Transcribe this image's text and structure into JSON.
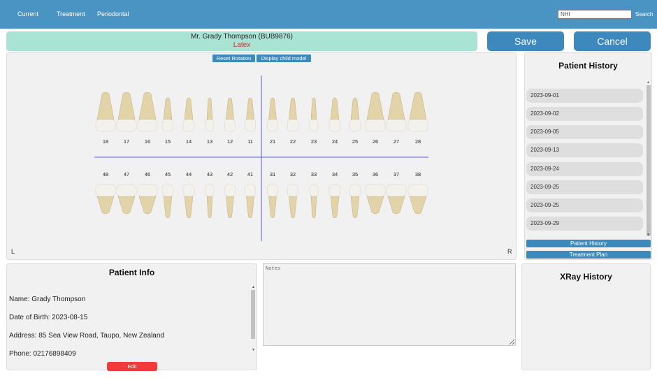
{
  "nav": {
    "items": [
      "Current",
      "Treatment",
      "Periodontal"
    ],
    "search_placeholder": "NHI",
    "search_label": "Search"
  },
  "patient": {
    "name": "Mr. Grady Thompson (BUB9876)",
    "allergy": "Latex"
  },
  "actions": {
    "save": "Save",
    "cancel": "Cancel"
  },
  "chart": {
    "reset_rotation": "Reset Rotation",
    "display_child_model": "Display child model",
    "left_label": "L",
    "right_label": "R",
    "upper_teeth": [
      "18",
      "17",
      "16",
      "15",
      "14",
      "13",
      "12",
      "11",
      "21",
      "22",
      "23",
      "24",
      "25",
      "26",
      "27",
      "28"
    ],
    "lower_teeth": [
      "48",
      "47",
      "46",
      "45",
      "44",
      "43",
      "42",
      "41",
      "31",
      "32",
      "33",
      "34",
      "35",
      "36",
      "37",
      "38"
    ]
  },
  "history": {
    "title": "Patient History",
    "dates": [
      "2023-09-01",
      "2023-09-02",
      "2023-09-05",
      "2023-09-13",
      "2023-09-24",
      "2023-09-25",
      "2023-09-25",
      "2023-09-29"
    ],
    "tab_history": "Patient History",
    "tab_treatment": "Treatment Plan"
  },
  "info": {
    "title": "Patient Info",
    "lines": [
      "Name: Grady Thompson",
      "Date of Birth: 2023-08-15",
      "Address: 85 Sea View Road, Taupo, New Zealand",
      "Phone: 02176898409"
    ],
    "edit": "Edit"
  },
  "notes": {
    "placeholder": "Notes"
  },
  "xray": {
    "title": "XRay History"
  },
  "colors": {
    "topbar": "#4a94c4",
    "button": "#3d88bd",
    "banner": "#a8e3d4",
    "allergy": "#d62a2a",
    "edit": "#f23a3a",
    "crown": "#f3f1eb",
    "root": "#e3d3a8",
    "axis": "#5b5bd6"
  }
}
